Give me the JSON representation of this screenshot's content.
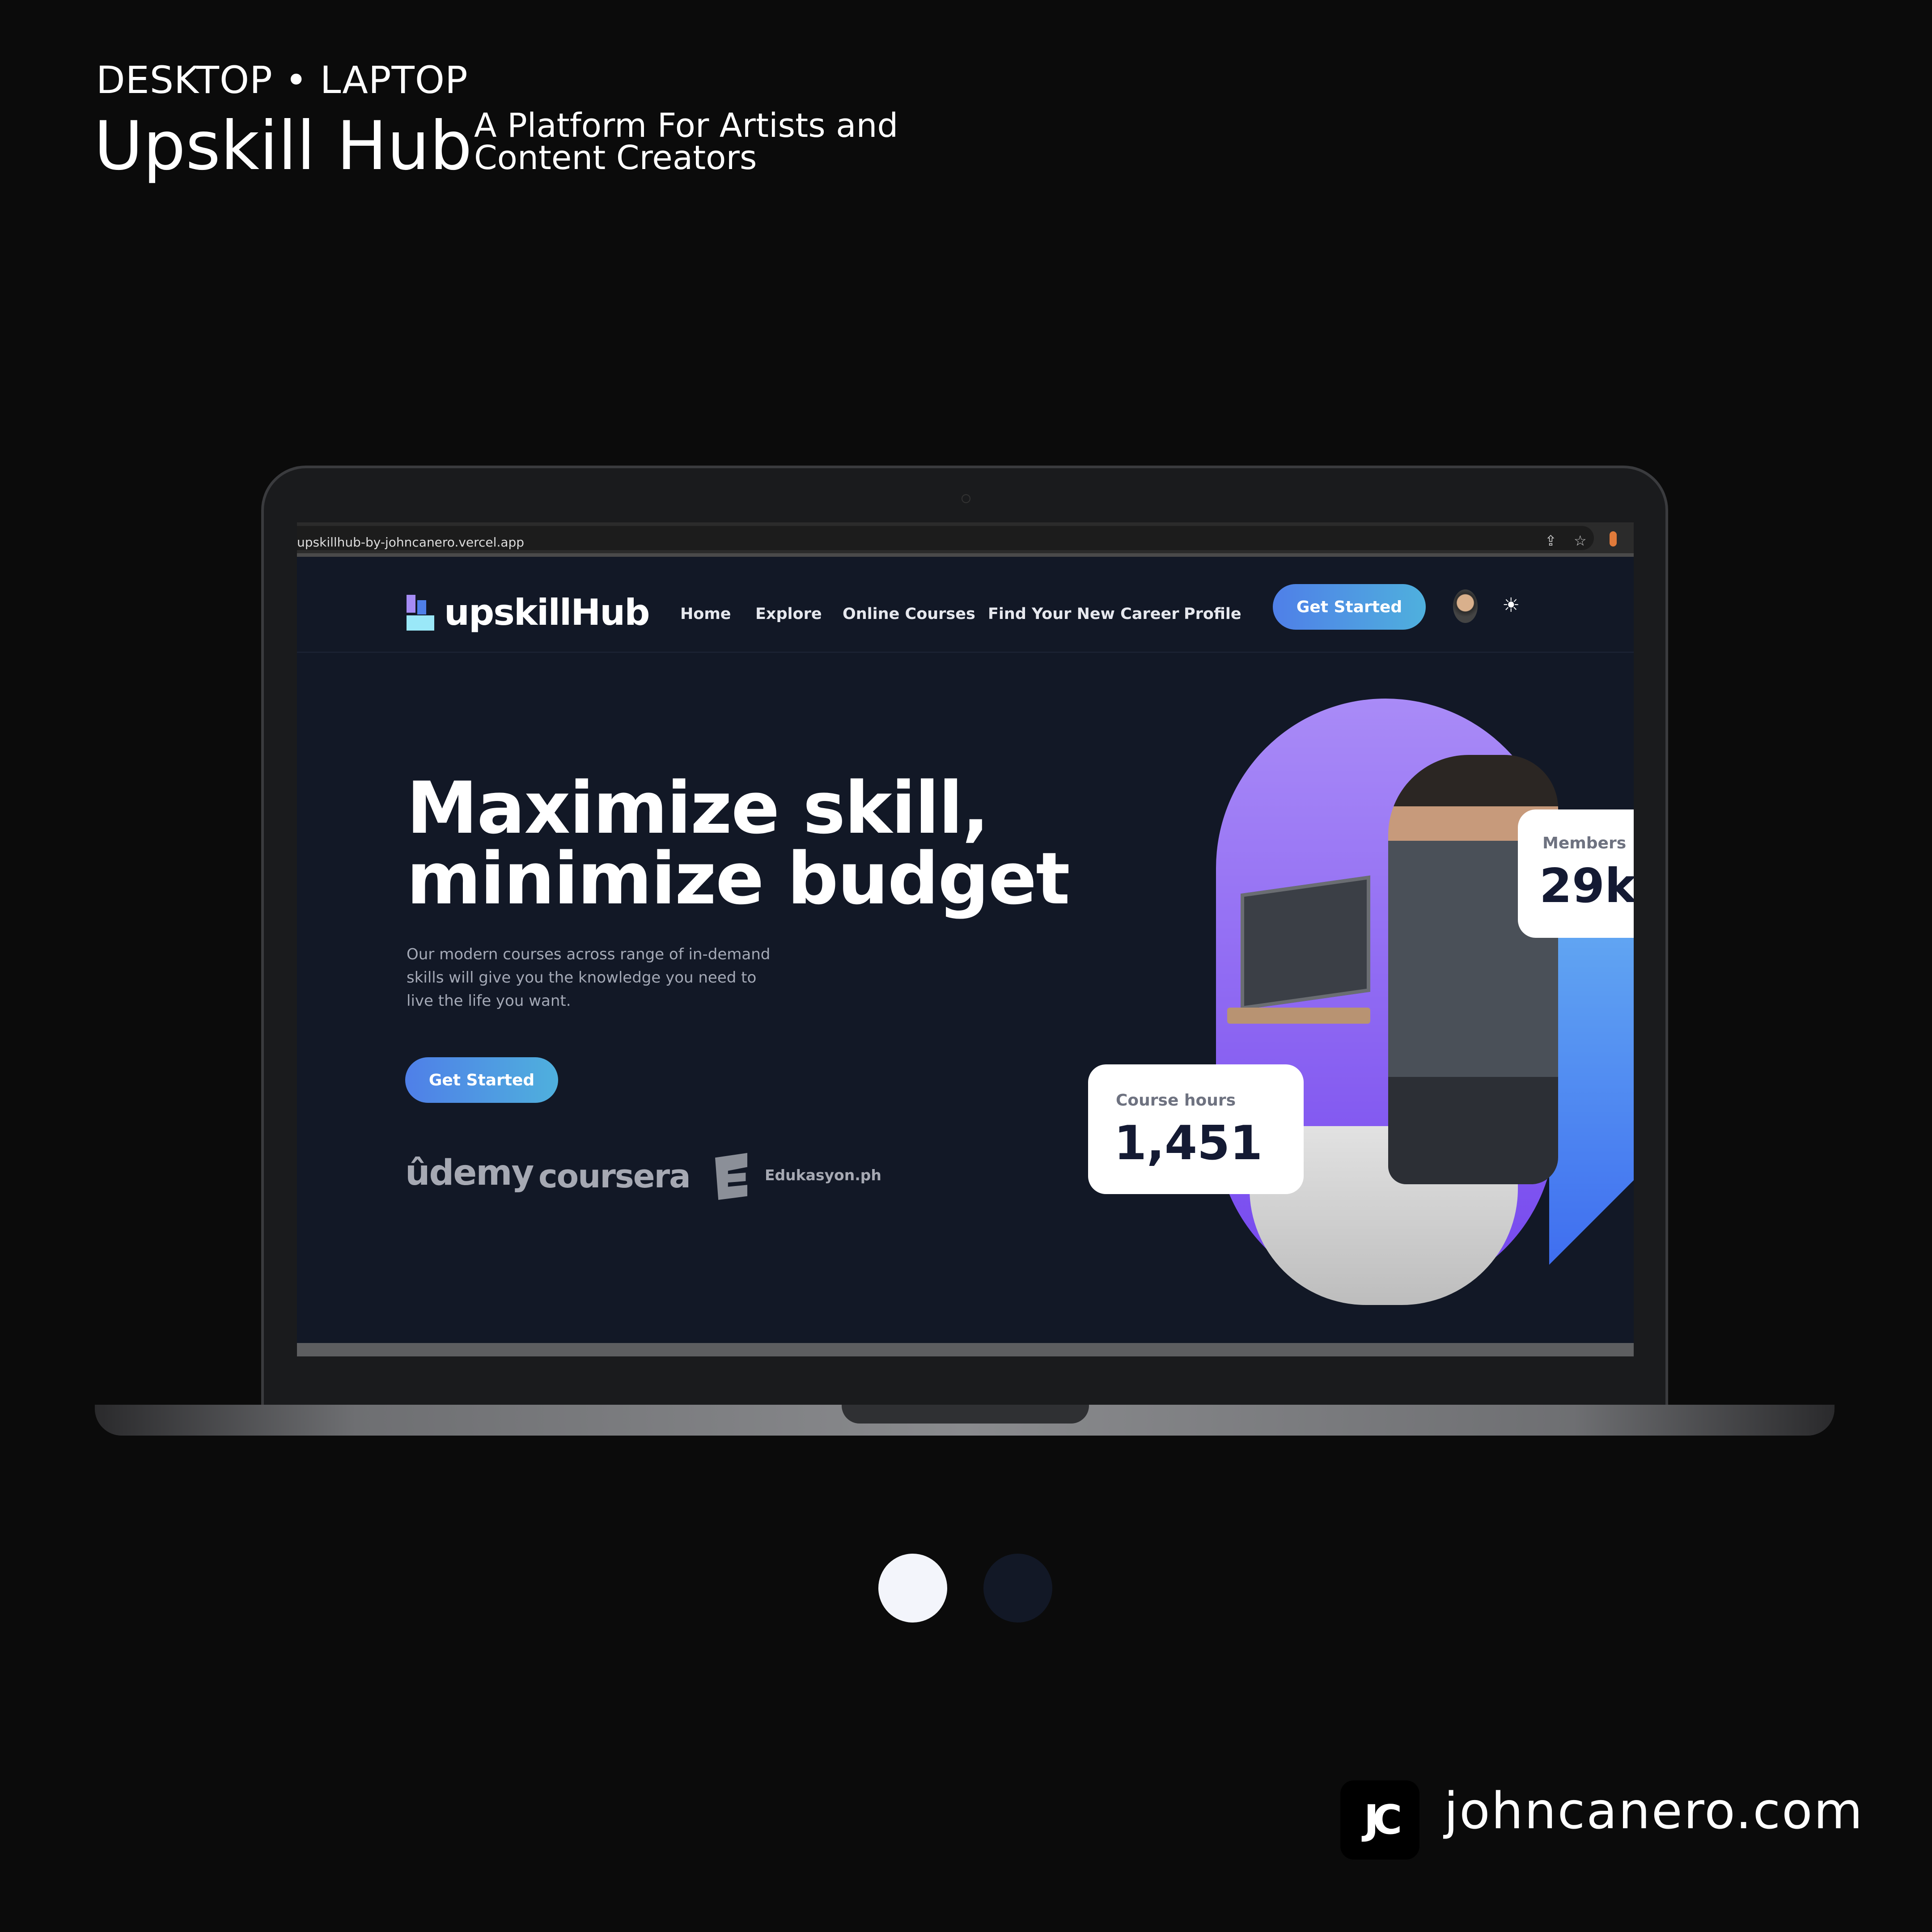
{
  "header": {
    "kicker": "DESKTOP • LAPTOP",
    "title": "Upskill Hub",
    "subtitle_line1": "A Platform For Artists and",
    "subtitle_line2": "Content Creators"
  },
  "browser": {
    "url": "upskillhub-by-johncanero.vercel.app",
    "icons": [
      "share-icon",
      "star-icon",
      "extension-icon"
    ]
  },
  "site": {
    "logo": "upskillHub",
    "nav": [
      {
        "label": "Home"
      },
      {
        "label": "Explore"
      },
      {
        "label": "Online Courses"
      },
      {
        "label": "Find Your New Career"
      },
      {
        "label": "Profile"
      }
    ],
    "cta": "Get Started",
    "hero": {
      "line1": "Maximize skill,",
      "line2": "minimize budget",
      "description": "Our modern courses across range of in-demand skills will give you the knowledge you need to live the life you want.",
      "cta": "Get Started"
    },
    "partners": {
      "udemy": "ûdemy",
      "coursera": "coursera",
      "edukasyon": "Edukasyon.ph"
    },
    "stats": {
      "members_label": "Members",
      "members_value": "29k",
      "hours_label": "Course hours",
      "hours_value": "1,451"
    }
  },
  "theme_colors": {
    "light": "#f3f5fb",
    "dark": "#121826",
    "accent": "#4f7fe8"
  },
  "footer": {
    "brand_mark": "JC",
    "brand": "johncanero.com"
  }
}
